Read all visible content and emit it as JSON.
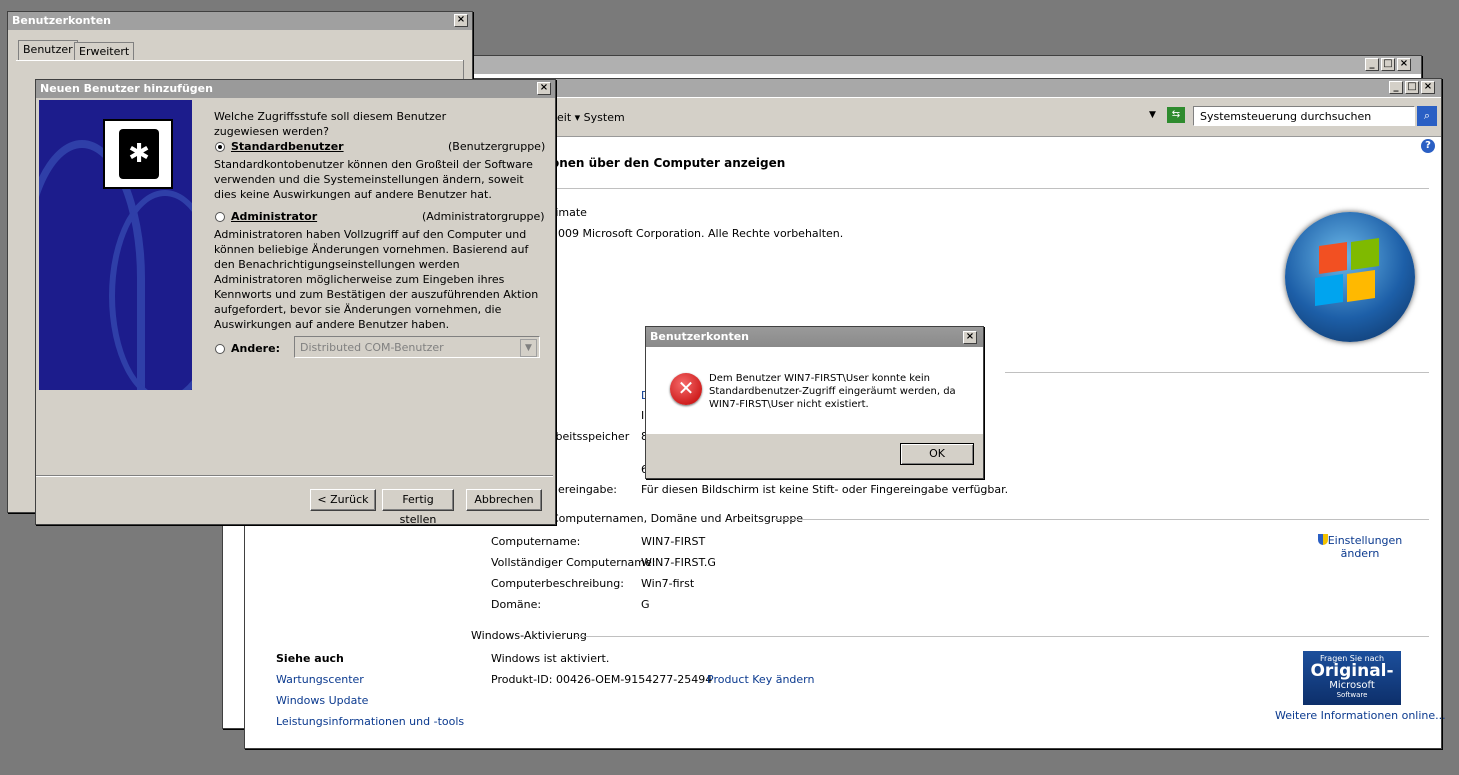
{
  "back_window": {
    "buttons": [
      "_",
      "□",
      "×"
    ]
  },
  "system": {
    "breadcrumb_tail": "eit ▾ System",
    "search_placeholder": "Systemsteuerung durchsuchen",
    "heading": "onen über den Computer anzeigen",
    "edition_tail": "timate",
    "copyright_tail": "2009 Microsoft Corporation. Alle Rechte vorbehalten.",
    "sp_tail": "1",
    "partial": [
      "D",
      "I",
      "8",
      "6"
    ],
    "memory_label_tail": "rbeitsspeicher",
    "pen_label_tail": "gereingabe:",
    "pen_value": "Für diesen Bildschirm ist keine Stift- oder Fingereingabe verfügbar.",
    "group_title_tail": "Computernamen, Domäne und Arbeitsgruppe",
    "rows": [
      {
        "label": "Computername:",
        "value": "WIN7-FIRST"
      },
      {
        "label": "Vollständiger Computername:",
        "value": "WIN7-FIRST.G"
      },
      {
        "label": "Computerbeschreibung:",
        "value": "Win7-first"
      },
      {
        "label": "Domäne:",
        "value": "G"
      }
    ],
    "change_settings": [
      "Einstellungen",
      "ändern"
    ],
    "activation_title": "Windows-Aktivierung",
    "activated": "Windows ist aktiviert.",
    "product_id": "Produkt-ID: 00426-OEM-9154277-25494",
    "change_key": "Product Key ändern",
    "genuine": [
      "Fragen Sie nach",
      "Original-",
      "Microsoft",
      "Software"
    ],
    "more_info": "Weitere Informationen online...",
    "see_also_title": "Siehe auch",
    "see_also": [
      "Wartungscenter",
      "Windows Update",
      "Leistungsinformationen und -tools"
    ]
  },
  "user_accounts": {
    "title": "Benutzerkonten",
    "tabs": [
      "Benutzer",
      "Erweitert"
    ]
  },
  "wizard": {
    "title": "Neuen Benutzer hinzufügen",
    "question": "Welche Zugriffsstufe soll diesem Benutzer zugewiesen werden?",
    "standard_label": "Standardbenutzer",
    "standard_group": "(Benutzergruppe)",
    "standard_desc": "Standardkontobenutzer können den Großteil der Software verwenden und die Systemeinstellungen ändern, soweit dies keine Auswirkungen auf andere Benutzer hat.",
    "admin_label": "Administrator",
    "admin_group": "(Administratorgruppe)",
    "admin_desc": "Administratoren haben Vollzugriff auf den Computer und können beliebige Änderungen vornehmen. Basierend auf den Benachrichtigungseinstellungen werden Administratoren möglicherweise zum Eingeben ihres Kennworts und zum Bestätigen der auszuführenden Aktion aufgefordert, bevor sie Änderungen vornehmen, die Auswirkungen auf andere Benutzer haben.",
    "other_label": "Andere:",
    "other_value": "Distributed COM-Benutzer",
    "back": "< Zurück",
    "finish": "Fertig stellen",
    "cancel": "Abbrechen"
  },
  "error": {
    "title": "Benutzerkonten",
    "message": "Dem Benutzer WIN7-FIRST\\User konnte kein Standardbenutzer-Zugriff eingeräumt werden, da WIN7-FIRST\\User nicht existiert.",
    "ok": "OK"
  },
  "colors": {
    "link": "#0b3a8f",
    "sidebar": "#1c1c8c",
    "error": "#d42020"
  }
}
